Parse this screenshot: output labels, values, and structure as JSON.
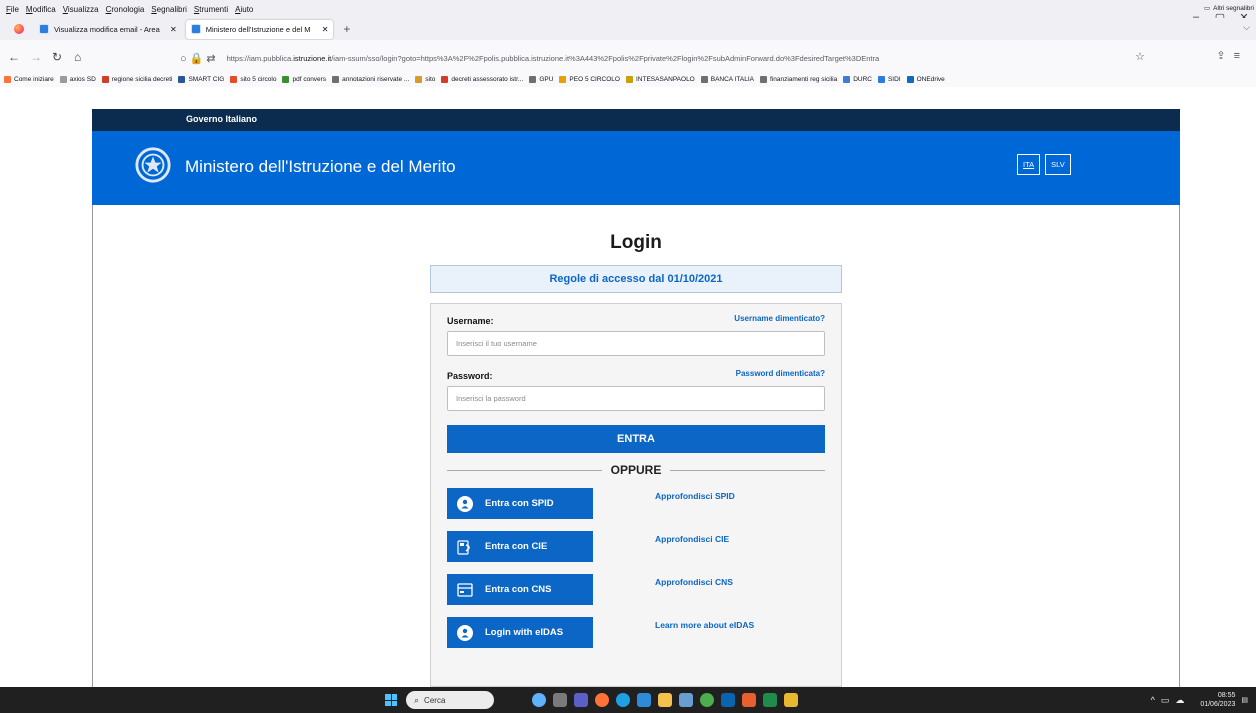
{
  "browser": {
    "menu": [
      "File",
      "Modifica",
      "Visualizza",
      "Cronologia",
      "Segnalibri",
      "Strumenti",
      "Aiuto"
    ],
    "window_controls": [
      "–",
      "▢",
      "✕"
    ],
    "tabs": [
      {
        "label": "Visualizza modifica email - Area",
        "active": false
      },
      {
        "label": "Ministero dell'Istruzione e del M",
        "active": true
      }
    ],
    "new_tab": "+",
    "tab_list": "⌵",
    "url_prefix": "https://iam.pubblica.",
    "url_host": "istruzione.it",
    "url_rest": "/iam-ssum/sso/login?goto=https%3A%2F%2Fpolis.pubblica.istruzione.it%3A443%2Fpolis%2Fprivate%2Flogin%2FsubAdminForward.do%3FdesiredTarget%3DEntra",
    "bookmarks": [
      {
        "label": "Come iniziare",
        "color": "#ff7139"
      },
      {
        "label": "axios SD",
        "color": "#9b9b9b"
      },
      {
        "label": "regione sicilia decreti",
        "color": "#d23c2a"
      },
      {
        "label": "SMART CIG",
        "color": "#2b5797"
      },
      {
        "label": "sito 5 circolo",
        "color": "#e44d26"
      },
      {
        "label": "pdf convers",
        "color": "#3b8f2f"
      },
      {
        "label": "annotazioni riservate ...",
        "color": "#6f6f6f"
      },
      {
        "label": "sito",
        "color": "#d79b2a"
      },
      {
        "label": "decreti assessorato istr...",
        "color": "#d23c2a"
      },
      {
        "label": "GPU",
        "color": "#6f6f6f"
      },
      {
        "label": "PEO 5 CIRCOLO",
        "color": "#e6a100"
      },
      {
        "label": "INTESASANPAOLO",
        "color": "#c8a200"
      },
      {
        "label": "BANCA ITALIA",
        "color": "#6f6f6f"
      },
      {
        "label": "finanziamenti reg sicilia",
        "color": "#6f6f6f"
      },
      {
        "label": "DURC",
        "color": "#3c7ed6"
      },
      {
        "label": "SIDI",
        "color": "#2d7de0"
      },
      {
        "label": "ONEdrive",
        "color": "#0f6cbd"
      }
    ],
    "other_bookmarks": "Altri segnalibri"
  },
  "site": {
    "gov_bar": "Governo Italiano",
    "brand": "Ministero dell'Istruzione e del Merito",
    "languages": [
      {
        "label": "ITA",
        "selected": true
      },
      {
        "label": "SLV",
        "selected": false
      }
    ]
  },
  "login": {
    "title": "Login",
    "rules": "Regole di accesso dal 01/10/2021",
    "username_label": "Username:",
    "username_forgot": "Username dimenticato?",
    "username_placeholder": "Inserisci il tuo username",
    "password_label": "Password:",
    "password_forgot": "Password dimenticata?",
    "password_placeholder": "Inserisci la password",
    "enter": "ENTRA",
    "or": "OPPURE",
    "methods": [
      {
        "button": "Entra con SPID",
        "link": "Approfondisci SPID",
        "icon": "spid-icon"
      },
      {
        "button": "Entra con CIE",
        "link": "Approfondisci CIE",
        "icon": "cie-icon"
      },
      {
        "button": "Entra con CNS",
        "link": "Approfondisci CNS",
        "icon": "cns-icon"
      },
      {
        "button": "Login with eIDAS",
        "link": "Learn more about eIDAS",
        "icon": "eidas-icon"
      }
    ]
  },
  "taskbar": {
    "search": "Cerca",
    "time": "08:55",
    "date": "01/06/2023"
  }
}
